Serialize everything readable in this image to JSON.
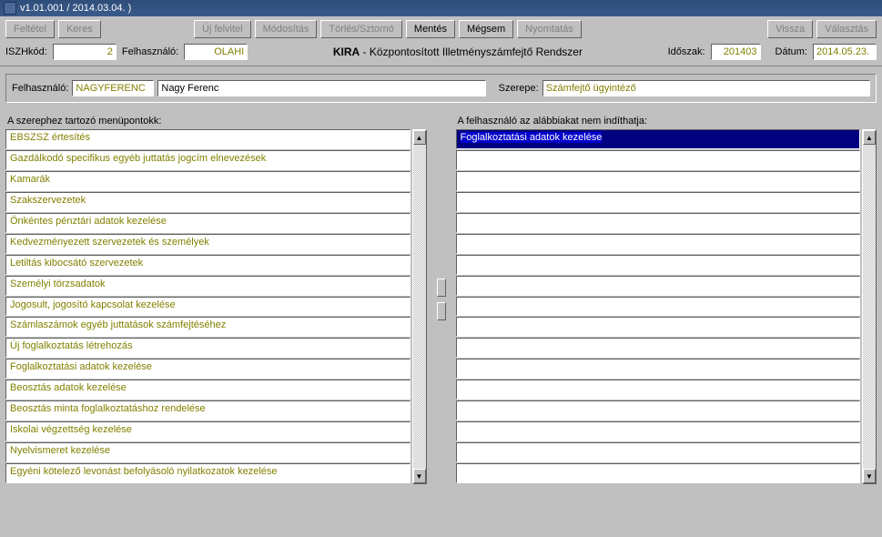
{
  "window": {
    "title": "v1.01.001 / 2014.03.04. )"
  },
  "toolbar": {
    "feltetel": "Feltétel",
    "keres": "Keres",
    "uj_felvitel": "Új felvitel",
    "modositas": "Módosítás",
    "torles": "Törlés/Sztornó",
    "mentes": "Mentés",
    "megsem": "Mégsem",
    "nyomtatas": "Nyomtatás",
    "vissza": "Vissza",
    "valasztas": "Választás"
  },
  "header": {
    "iszh_label": "ISZHkód:",
    "iszh_value": "2",
    "felhasznalo_label": "Felhasználó:",
    "felhasznalo_value": "OLAHI",
    "apptitle_strong": "KIRA",
    "apptitle_rest": " - Központosított Illetményszámfejtő Rendszer",
    "idoszak_label": "Időszak:",
    "idoszak_value": "201403",
    "datum_label": "Dátum:",
    "datum_value": "2014.05.23."
  },
  "user": {
    "felhasznalo_label": "Felhasználó:",
    "code": "NAGYFERENC",
    "name": "Nagy Ferenc",
    "szerepe_label": "Szerepe:",
    "szerepe_value": "Számfejtő ügyintéző"
  },
  "lists": {
    "left_title": "A szerephez tartozó menüpontokk:",
    "right_title": "A felhasználó az alábbiakat nem indíthatja:",
    "left_items": [
      "EBSZSZ értesítés",
      "Gazdálkodó specifikus egyéb juttatás jogcím elnevezések",
      "Kamarák",
      "Szakszervezetek",
      "Önkéntes pénztári adatok kezelése",
      "Kedvezményezett szervezetek és személyek",
      "Letiltás kibocsátó szervezetek",
      "Személyi törzsadatok",
      "Jogosult, jogosító kapcsolat kezelése",
      "Számlaszámok egyéb juttatások számfejtéséhez",
      "Új foglalkoztatás létrehozás",
      "Foglalkoztatási adatok kezelése",
      "Beosztás adatok kezelése",
      "Beosztás minta foglalkoztatáshoz rendelése",
      "Iskolai végzettség kezelése",
      "Nyelvismeret kezelése",
      "Egyéni kötelező levonást befolyásoló nyilatkozatok kezelése"
    ],
    "right_items": [
      "Foglalkoztatási adatok kezelése",
      "",
      "",
      "",
      "",
      "",
      "",
      "",
      "",
      "",
      "",
      "",
      "",
      "",
      "",
      "",
      ""
    ],
    "right_selected_index": 0
  }
}
